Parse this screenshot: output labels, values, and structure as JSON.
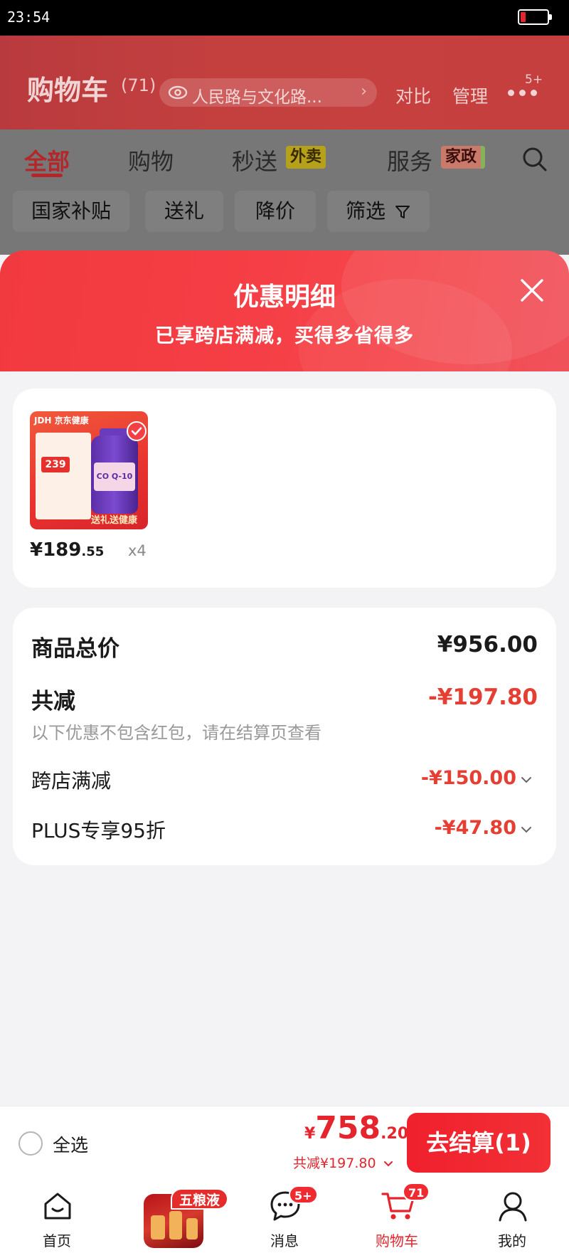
{
  "status_bar": {
    "time": "23:54"
  },
  "cart_header": {
    "title": "购物车",
    "count": "(71)",
    "address": "人民路与文化路...",
    "compare": "对比",
    "manage": "管理",
    "more_badge": "5+"
  },
  "tabs": [
    {
      "label": "全部",
      "active": true
    },
    {
      "label": "购物"
    },
    {
      "label": "秒送",
      "tag": "外卖"
    },
    {
      "label": "服务",
      "tag": "家政"
    }
  ],
  "filters": [
    "国家补贴",
    "送礼",
    "降价",
    "筛选"
  ],
  "modal": {
    "title": "优惠明细",
    "subtitle": "已享跨店满减，买得多省得多"
  },
  "item": {
    "price_int": "¥189",
    "price_dec": ".55",
    "qty": "x4",
    "image_text": {
      "brand": "JDH 京东健康",
      "tag_price": "239",
      "label": "CO Q-10",
      "footer": "送礼送健康"
    }
  },
  "summary": {
    "total_label": "商品总价",
    "total_value": "¥956.00",
    "discount_label": "共减",
    "discount_value": "-¥197.80",
    "note": "以下优惠不包含红包，请在结算页查看",
    "rows": [
      {
        "label": "跨店满减",
        "value": "-¥150.00"
      },
      {
        "label": "PLUS专享95折",
        "value": "-¥47.80"
      }
    ]
  },
  "checkout": {
    "select_all": "全选",
    "currency": "¥",
    "total_int": "758",
    "total_dec": ".20",
    "saved": "共减¥197.80",
    "button": "去结算(1)"
  },
  "bottom_nav": [
    {
      "label": "首页"
    },
    {
      "label": "五粮液",
      "promo": true
    },
    {
      "label": "消息",
      "badge": "5+"
    },
    {
      "label": "购物车",
      "badge": "71",
      "active": true
    },
    {
      "label": "我的"
    }
  ],
  "colors": {
    "accent_red": "#E4252D",
    "discount_red": "#E53F34",
    "header_red": "#C4403F"
  }
}
